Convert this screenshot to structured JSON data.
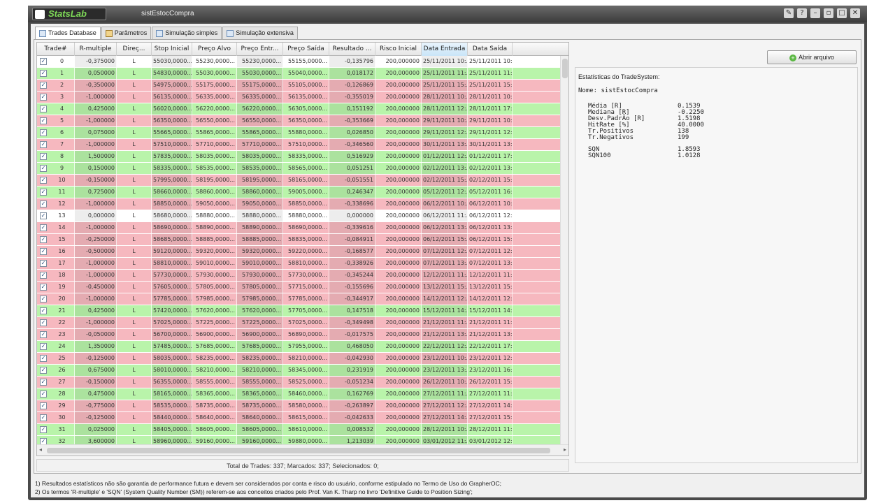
{
  "window": {
    "app_name": "StatsLab",
    "doc_title": "sistEstocCompra"
  },
  "tabs": [
    {
      "label": "Trades Database",
      "active": true
    },
    {
      "label": "Parâmetros",
      "active": false
    },
    {
      "label": "Simulação simples",
      "active": false
    },
    {
      "label": "Simulação extensiva",
      "active": false
    }
  ],
  "columns": [
    "Trade#",
    "R-multiple",
    "Direç...",
    "Stop Inicial",
    "Preço Alvo",
    "Preço Entr...",
    "Preço Saída",
    "Resultado ...",
    "Risco Inicial",
    "Data Entrada",
    "Data Saída"
  ],
  "rows": [
    [
      "0",
      "-0,375000",
      "L",
      "55030,0000...",
      "55230,0000...",
      "55230,0000...",
      "55155,0000...",
      "-0,135796",
      "200,000000",
      "25/11/2011 10:...",
      "25/11/2011 10:...",
      "w"
    ],
    [
      "1",
      "0,050000",
      "L",
      "54830,0000...",
      "55030,0000...",
      "55030,0000...",
      "55040,0000...",
      "0,018172",
      "200,000000",
      "25/11/2011 11:...",
      "25/11/2011 11:...",
      "g"
    ],
    [
      "2",
      "-0,350000",
      "L",
      "54975,0000...",
      "55175,0000...",
      "55175,0000...",
      "55105,0000...",
      "-0,126869",
      "200,000000",
      "25/11/2011 15:...",
      "25/11/2011 15:...",
      "r"
    ],
    [
      "3",
      "-1,000000",
      "L",
      "56135,0000...",
      "56335,0000...",
      "56335,0000...",
      "56135,0000...",
      "-0,355019",
      "200,000000",
      "28/11/2011 10:...",
      "28/11/2011 10:...",
      "r"
    ],
    [
      "4",
      "0,425000",
      "L",
      "56020,0000...",
      "56220,0000...",
      "56220,0000...",
      "56305,0000...",
      "0,151192",
      "200,000000",
      "28/11/2011 12:...",
      "28/11/2011 17:...",
      "g"
    ],
    [
      "5",
      "-1,000000",
      "L",
      "56350,0000...",
      "56550,0000...",
      "56550,0000...",
      "56350,0000...",
      "-0,353669",
      "200,000000",
      "29/11/2011 10:...",
      "29/11/2011 10:...",
      "r"
    ],
    [
      "6",
      "0,075000",
      "L",
      "55665,0000...",
      "55865,0000...",
      "55865,0000...",
      "55880,0000...",
      "0,026850",
      "200,000000",
      "29/11/2011 12:...",
      "29/11/2011 12:...",
      "g"
    ],
    [
      "7",
      "-1,000000",
      "L",
      "57510,0000...",
      "57710,0000...",
      "57710,0000...",
      "57510,0000...",
      "-0,346560",
      "200,000000",
      "30/11/2011 13:...",
      "30/11/2011 13:...",
      "r"
    ],
    [
      "8",
      "1,500000",
      "L",
      "57835,0000...",
      "58035,0000...",
      "58035,0000...",
      "58335,0000...",
      "0,516929",
      "200,000000",
      "01/12/2011 12:...",
      "01/12/2011 17:...",
      "g"
    ],
    [
      "9",
      "0,150000",
      "L",
      "58335,0000...",
      "58535,0000...",
      "58535,0000...",
      "58565,0000...",
      "0,051251",
      "200,000000",
      "02/12/2011 13:...",
      "02/12/2011 13:...",
      "g"
    ],
    [
      "10",
      "-0,150000",
      "L",
      "57995,0000...",
      "58195,0000...",
      "58195,0000...",
      "58165,0000...",
      "-0,051551",
      "200,000000",
      "02/12/2011 15:...",
      "02/12/2011 15:...",
      "r"
    ],
    [
      "11",
      "0,725000",
      "L",
      "58660,0000...",
      "58860,0000...",
      "58860,0000...",
      "59005,0000...",
      "0,246347",
      "200,000000",
      "05/12/2011 12:...",
      "05/12/2011 16:...",
      "g"
    ],
    [
      "12",
      "-1,000000",
      "L",
      "58850,0000...",
      "59050,0000...",
      "59050,0000...",
      "58850,0000...",
      "-0,338696",
      "200,000000",
      "06/12/2011 10:...",
      "06/12/2011 10:...",
      "r"
    ],
    [
      "13",
      "0,000000",
      "L",
      "58680,0000...",
      "58880,0000...",
      "58880,0000...",
      "58880,0000...",
      "0,000000",
      "200,000000",
      "06/12/2011 11:...",
      "06/12/2011 12:...",
      "w"
    ],
    [
      "14",
      "-1,000000",
      "L",
      "58690,0000...",
      "58890,0000...",
      "58890,0000...",
      "58690,0000...",
      "-0,339616",
      "200,000000",
      "06/12/2011 13:...",
      "06/12/2011 13:...",
      "r"
    ],
    [
      "15",
      "-0,250000",
      "L",
      "58685,0000...",
      "58885,0000...",
      "58885,0000...",
      "58835,0000...",
      "-0,084911",
      "200,000000",
      "06/12/2011 15:...",
      "06/12/2011 15:...",
      "r"
    ],
    [
      "16",
      "-0,500000",
      "L",
      "59120,0000...",
      "59320,0000...",
      "59320,0000...",
      "59220,0000...",
      "-0,168577",
      "200,000000",
      "07/12/2011 12:...",
      "07/12/2011 12:...",
      "r"
    ],
    [
      "17",
      "-1,000000",
      "L",
      "58810,0000...",
      "59010,0000...",
      "59010,0000...",
      "58810,0000...",
      "-0,338926",
      "200,000000",
      "07/12/2011 13:...",
      "07/12/2011 13:...",
      "r"
    ],
    [
      "18",
      "-1,000000",
      "L",
      "57730,0000...",
      "57930,0000...",
      "57930,0000...",
      "57730,0000...",
      "-0,345244",
      "200,000000",
      "12/12/2011 11:...",
      "12/12/2011 11:...",
      "r"
    ],
    [
      "19",
      "-0,450000",
      "L",
      "57605,0000...",
      "57805,0000...",
      "57805,0000...",
      "57715,0000...",
      "-0,155696",
      "200,000000",
      "13/12/2011 15:...",
      "13/12/2011 15:...",
      "r"
    ],
    [
      "20",
      "-1,000000",
      "L",
      "57785,0000...",
      "57985,0000...",
      "57985,0000...",
      "57785,0000...",
      "-0,344917",
      "200,000000",
      "14/12/2011 12:...",
      "14/12/2011 12:...",
      "r"
    ],
    [
      "21",
      "0,425000",
      "L",
      "57420,0000...",
      "57620,0000...",
      "57620,0000...",
      "57705,0000...",
      "0,147518",
      "200,000000",
      "15/12/2011 14:...",
      "15/12/2011 14:...",
      "g"
    ],
    [
      "22",
      "-1,000000",
      "L",
      "57025,0000...",
      "57225,0000...",
      "57225,0000...",
      "57025,0000...",
      "-0,349498",
      "200,000000",
      "21/12/2011 11:...",
      "21/12/2011 11:...",
      "r"
    ],
    [
      "23",
      "-0,050000",
      "L",
      "56700,0000...",
      "56900,0000...",
      "56900,0000...",
      "56890,0000...",
      "-0,017575",
      "200,000000",
      "21/12/2011 13:...",
      "21/12/2011 13:...",
      "r"
    ],
    [
      "24",
      "1,350000",
      "L",
      "57485,0000...",
      "57685,0000...",
      "57685,0000...",
      "57955,0000...",
      "0,468050",
      "200,000000",
      "22/12/2011 12:...",
      "22/12/2011 17:...",
      "g"
    ],
    [
      "25",
      "-0,125000",
      "L",
      "58035,0000...",
      "58235,0000...",
      "58235,0000...",
      "58210,0000...",
      "-0,042930",
      "200,000000",
      "23/12/2011 10:...",
      "23/12/2011 12:...",
      "r"
    ],
    [
      "26",
      "0,675000",
      "L",
      "58010,0000...",
      "58210,0000...",
      "58210,0000...",
      "58345,0000...",
      "0,231919",
      "200,000000",
      "23/12/2011 13:...",
      "23/12/2011 16:...",
      "g"
    ],
    [
      "27",
      "-0,150000",
      "L",
      "56355,0000...",
      "58555,0000...",
      "58555,0000...",
      "58525,0000...",
      "-0,051234",
      "200,000000",
      "26/12/2011 10:...",
      "26/12/2011 15:...",
      "r"
    ],
    [
      "28",
      "0,475000",
      "L",
      "58165,0000...",
      "58365,0000...",
      "58365,0000...",
      "58460,0000...",
      "0,162769",
      "200,000000",
      "27/12/2011 11:...",
      "27/12/2011 11:...",
      "g"
    ],
    [
      "29",
      "-0,775000",
      "L",
      "58535,0000...",
      "58735,0000...",
      "58735,0000...",
      "58580,0000...",
      "-0,263897",
      "200,000000",
      "27/12/2011 12:...",
      "27/12/2011 14:...",
      "r"
    ],
    [
      "30",
      "-0,125000",
      "L",
      "58440,0000...",
      "58640,0000...",
      "58640,0000...",
      "58615,0000...",
      "-0,042633",
      "200,000000",
      "27/12/2011 14:...",
      "27/12/2011 15:...",
      "r"
    ],
    [
      "31",
      "0,025000",
      "L",
      "58405,0000...",
      "58605,0000...",
      "58605,0000...",
      "58610,0000...",
      "0,008532",
      "200,000000",
      "28/12/2011 10:...",
      "28/12/2011 11:...",
      "g"
    ],
    [
      "32",
      "3,600000",
      "L",
      "58960,0000...",
      "59160,0000...",
      "59160,0000...",
      "59880,0000...",
      "1,213039",
      "200,000000",
      "03/01/2012 11:...",
      "03/01/2012 12:...",
      "g"
    ]
  ],
  "totals": "Total de Trades: 337; Marcados: 337; Selecionados: 0;",
  "open_button": "Abrir arquivo",
  "stats": {
    "title": "Estatísticas do TradeSystem:",
    "name_line": "Nome: sistEstocCompra",
    "lines": [
      {
        "label": "Média [R]",
        "value": "0.1539"
      },
      {
        "label": "Mediana [R]",
        "value": "-0.2250"
      },
      {
        "label": "Desv.PadrÃo [R]",
        "value": "1.5198"
      },
      {
        "label": "HitRate [%]",
        "value": "40.0000"
      },
      {
        "label": "Tr.Positivos",
        "value": "138"
      },
      {
        "label": "Tr.Negativos",
        "value": "199"
      }
    ],
    "lines2": [
      {
        "label": "SQN",
        "value": "1.8593"
      },
      {
        "label": "SQN100",
        "value": "1.0128"
      }
    ]
  },
  "footer": [
    "1) Resultados estatísticos não são garantia de performance futura e devem ser considerados por conta e risco do usuário, conforme estipulado no Termo de Uso do GrapherOC;",
    "2) Os termos 'R-multiple' e 'SQN' (System Quality Number (SM)) referem-se aos conceitos criados pelo Prof. Van K. Tharp no livro 'Definitive Guide to Position Sizing';"
  ],
  "colors": {
    "win_row": "#b9f4aa",
    "loss_row": "#f6b8bf",
    "flat_row": "#ffffff",
    "titlebar": "#4a4a4a"
  }
}
